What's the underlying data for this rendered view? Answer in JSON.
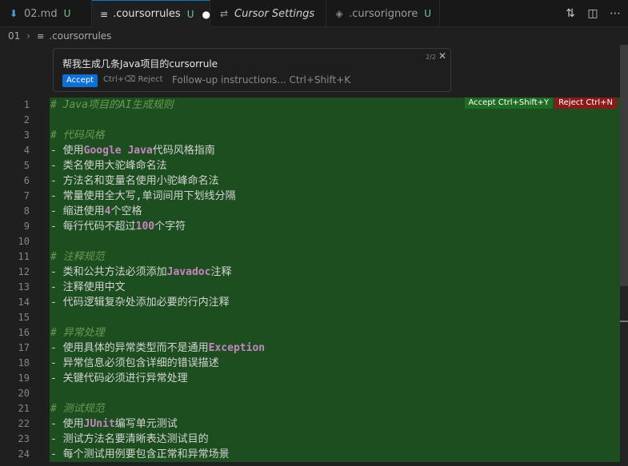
{
  "tabs": [
    {
      "label": "02.md",
      "status": "U",
      "icon": "download-arrow-icon"
    },
    {
      "label": ".coursorrules",
      "status": "U",
      "icon": "lines-icon",
      "active": true
    },
    {
      "label": "Cursor Settings",
      "icon": "sliders-icon"
    },
    {
      "label": ".cursorignore",
      "status": "U",
      "icon": "diamond-icon"
    }
  ],
  "breadcrumb": {
    "folder": "01",
    "file": ".coursorrules"
  },
  "prompt": {
    "title": "帮我生成几条Java项目的cursorrule",
    "pager": "2/2",
    "accept_label": "Accept",
    "reject_label": "Ctrl+⌫ Reject",
    "followup_placeholder": "Follow-up instructions... Ctrl+Shift+K"
  },
  "diff_actions": {
    "accept": "Accept Ctrl+Shift+Y",
    "reject": "Reject Ctrl+N"
  },
  "lines": [
    {
      "n": "1",
      "type": "comment",
      "parts": [
        {
          "t": "# Java项目的AI生成规则"
        }
      ]
    },
    {
      "n": "2",
      "type": "blank",
      "parts": []
    },
    {
      "n": "3",
      "type": "comment",
      "parts": [
        {
          "t": "# 代码风格"
        }
      ]
    },
    {
      "n": "4",
      "type": "text",
      "parts": [
        {
          "t": "- 使用"
        },
        {
          "t": "Google Java",
          "k": true
        },
        {
          "t": "代码风格指南"
        }
      ]
    },
    {
      "n": "5",
      "type": "text",
      "parts": [
        {
          "t": "- 类名使用大驼峰命名法"
        }
      ]
    },
    {
      "n": "6",
      "type": "text",
      "parts": [
        {
          "t": "- 方法名和变量名使用小驼峰命名法"
        }
      ]
    },
    {
      "n": "7",
      "type": "text",
      "parts": [
        {
          "t": "- 常量使用全大写,单词间用下划线分隔"
        }
      ]
    },
    {
      "n": "8",
      "type": "text",
      "parts": [
        {
          "t": "- 缩进使用"
        },
        {
          "t": "4",
          "k": true
        },
        {
          "t": "个空格"
        }
      ]
    },
    {
      "n": "9",
      "type": "text",
      "parts": [
        {
          "t": "- 每行代码不超过"
        },
        {
          "t": "100",
          "k": true
        },
        {
          "t": "个字符"
        }
      ]
    },
    {
      "n": "10",
      "type": "blank",
      "parts": []
    },
    {
      "n": "11",
      "type": "comment",
      "parts": [
        {
          "t": "# 注释规范"
        }
      ]
    },
    {
      "n": "12",
      "type": "text",
      "parts": [
        {
          "t": "- 类和公共方法必须添加"
        },
        {
          "t": "Javadoc",
          "k": true
        },
        {
          "t": "注释"
        }
      ]
    },
    {
      "n": "13",
      "type": "text",
      "parts": [
        {
          "t": "- 注释使用中文"
        }
      ]
    },
    {
      "n": "14",
      "type": "text",
      "parts": [
        {
          "t": "- 代码逻辑复杂处添加必要的行内注释"
        }
      ]
    },
    {
      "n": "15",
      "type": "blank",
      "parts": []
    },
    {
      "n": "16",
      "type": "comment",
      "parts": [
        {
          "t": "# 异常处理"
        }
      ]
    },
    {
      "n": "17",
      "type": "text",
      "parts": [
        {
          "t": "- 使用具体的异常类型而不是通用"
        },
        {
          "t": "Exception",
          "k": true
        }
      ]
    },
    {
      "n": "18",
      "type": "text",
      "parts": [
        {
          "t": "- 异常信息必须包含详细的错误描述"
        }
      ]
    },
    {
      "n": "19",
      "type": "text",
      "parts": [
        {
          "t": "- 关键代码必须进行异常处理"
        }
      ]
    },
    {
      "n": "20",
      "type": "blank",
      "parts": []
    },
    {
      "n": "21",
      "type": "comment",
      "parts": [
        {
          "t": "# 测试规范"
        }
      ]
    },
    {
      "n": "22",
      "type": "text",
      "parts": [
        {
          "t": "- 使用"
        },
        {
          "t": "JUnit",
          "k": true
        },
        {
          "t": "编写单元测试"
        }
      ]
    },
    {
      "n": "23",
      "type": "text",
      "parts": [
        {
          "t": "- 测试方法名要清晰表达测试目的"
        }
      ]
    },
    {
      "n": "24",
      "type": "text",
      "parts": [
        {
          "t": "- 每个测试用例要包含正常和异常场景"
        }
      ]
    }
  ],
  "colors": {
    "accent": "#0078d4",
    "diff_add": "#1d4e1f",
    "keyword": "#c586c0",
    "comment": "#6a9955"
  }
}
